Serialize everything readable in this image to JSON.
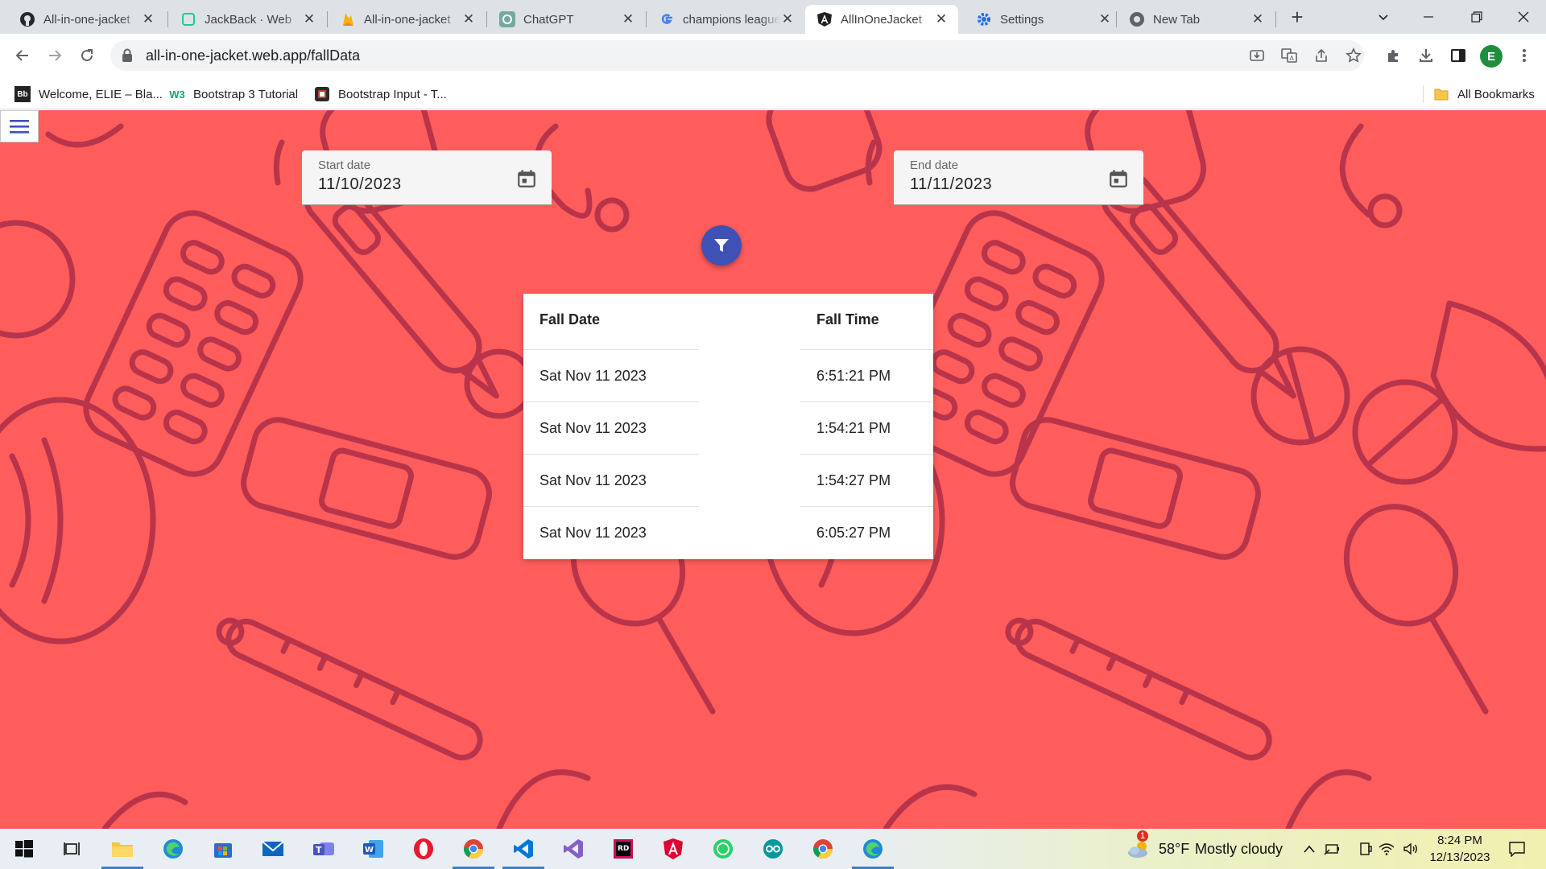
{
  "browser": {
    "tabs": [
      {
        "title": "All-in-one-jacket",
        "icon": "github-icon",
        "active": false
      },
      {
        "title": "JackBack · Web",
        "icon": "jackback-icon",
        "active": false
      },
      {
        "title": "All-in-one-jacket",
        "icon": "firebase-icon",
        "active": false
      },
      {
        "title": "ChatGPT",
        "icon": "chatgpt-icon",
        "active": false
      },
      {
        "title": "champions league",
        "icon": "google-icon",
        "active": false
      },
      {
        "title": "AllInOneJacket",
        "icon": "angular-icon",
        "active": true
      },
      {
        "title": "Settings",
        "icon": "settings-gear-icon",
        "active": false
      },
      {
        "title": "New Tab",
        "icon": "chrome-icon",
        "active": false
      }
    ],
    "url": "all-in-one-jacket.web.app/fallData",
    "profile_initial": "E",
    "bookmarks": [
      {
        "label": "Welcome, ELIE – Bla...",
        "icon_text": "Bb"
      },
      {
        "label": "Bootstrap 3 Tutorial",
        "icon_text": "W3"
      },
      {
        "label": "Bootstrap Input - T...",
        "icon_text": ""
      }
    ],
    "all_bookmarks_label": "All Bookmarks"
  },
  "page": {
    "background_color": "#ff5c5c",
    "pattern_color": "#b8344a",
    "start_date": {
      "label": "Start date",
      "value": "11/10/2023"
    },
    "end_date": {
      "label": "End date",
      "value": "11/11/2023"
    },
    "filter_button_color": "#3f51b5",
    "table": {
      "headers": [
        "Fall Date",
        "Fall Time"
      ],
      "rows": [
        [
          "Sat Nov 11 2023",
          "6:51:21 PM"
        ],
        [
          "Sat Nov 11 2023",
          "1:54:21 PM"
        ],
        [
          "Sat Nov 11 2023",
          "1:54:27 PM"
        ],
        [
          "Sat Nov 11 2023",
          "6:05:27 PM"
        ]
      ]
    }
  },
  "taskbar": {
    "weather": {
      "temp": "58°F",
      "condition": "Mostly cloudy",
      "badge": "1"
    },
    "clock": {
      "time": "8:24 PM",
      "date": "12/13/2023"
    }
  }
}
